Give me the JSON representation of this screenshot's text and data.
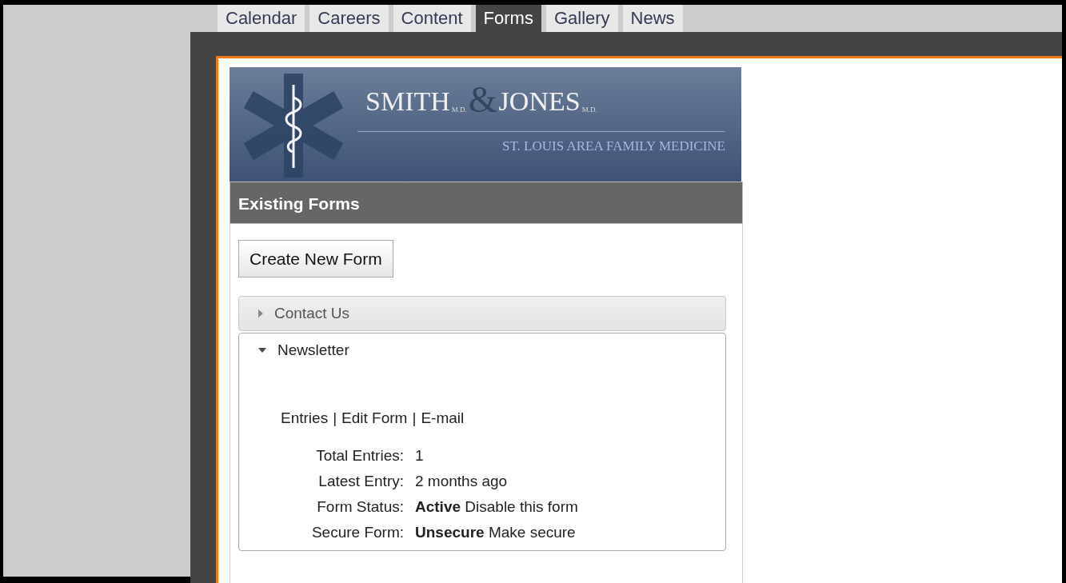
{
  "tabs": [
    {
      "label": "Calendar",
      "selected": false
    },
    {
      "label": "Careers",
      "selected": false
    },
    {
      "label": "Content",
      "selected": false
    },
    {
      "label": "Forms",
      "selected": true
    },
    {
      "label": "Gallery",
      "selected": false
    },
    {
      "label": "News",
      "selected": false
    }
  ],
  "banner": {
    "name_first": "SMITH",
    "suffix_first": "M.D.",
    "ampersand": "&",
    "name_second": "JONES",
    "suffix_second": "M.D.",
    "tagline": "ST. LOUIS AREA FAMILY MEDICINE"
  },
  "section_title": "Existing Forms",
  "create_button": "Create New Form",
  "forms": [
    {
      "title": "Contact Us",
      "expanded": false
    },
    {
      "title": "Newsletter",
      "expanded": true,
      "links": [
        "Entries",
        "Edit Form",
        "E-mail"
      ],
      "separator": "|",
      "details": [
        {
          "label": "Total Entries:",
          "value": "1"
        },
        {
          "label": "Latest Entry:",
          "value": "2 months ago"
        },
        {
          "label": "Form Status:",
          "value": "**Active** Disable this form"
        },
        {
          "label": "Secure Form:",
          "value": "**Unsecure** Make secure"
        }
      ]
    }
  ]
}
